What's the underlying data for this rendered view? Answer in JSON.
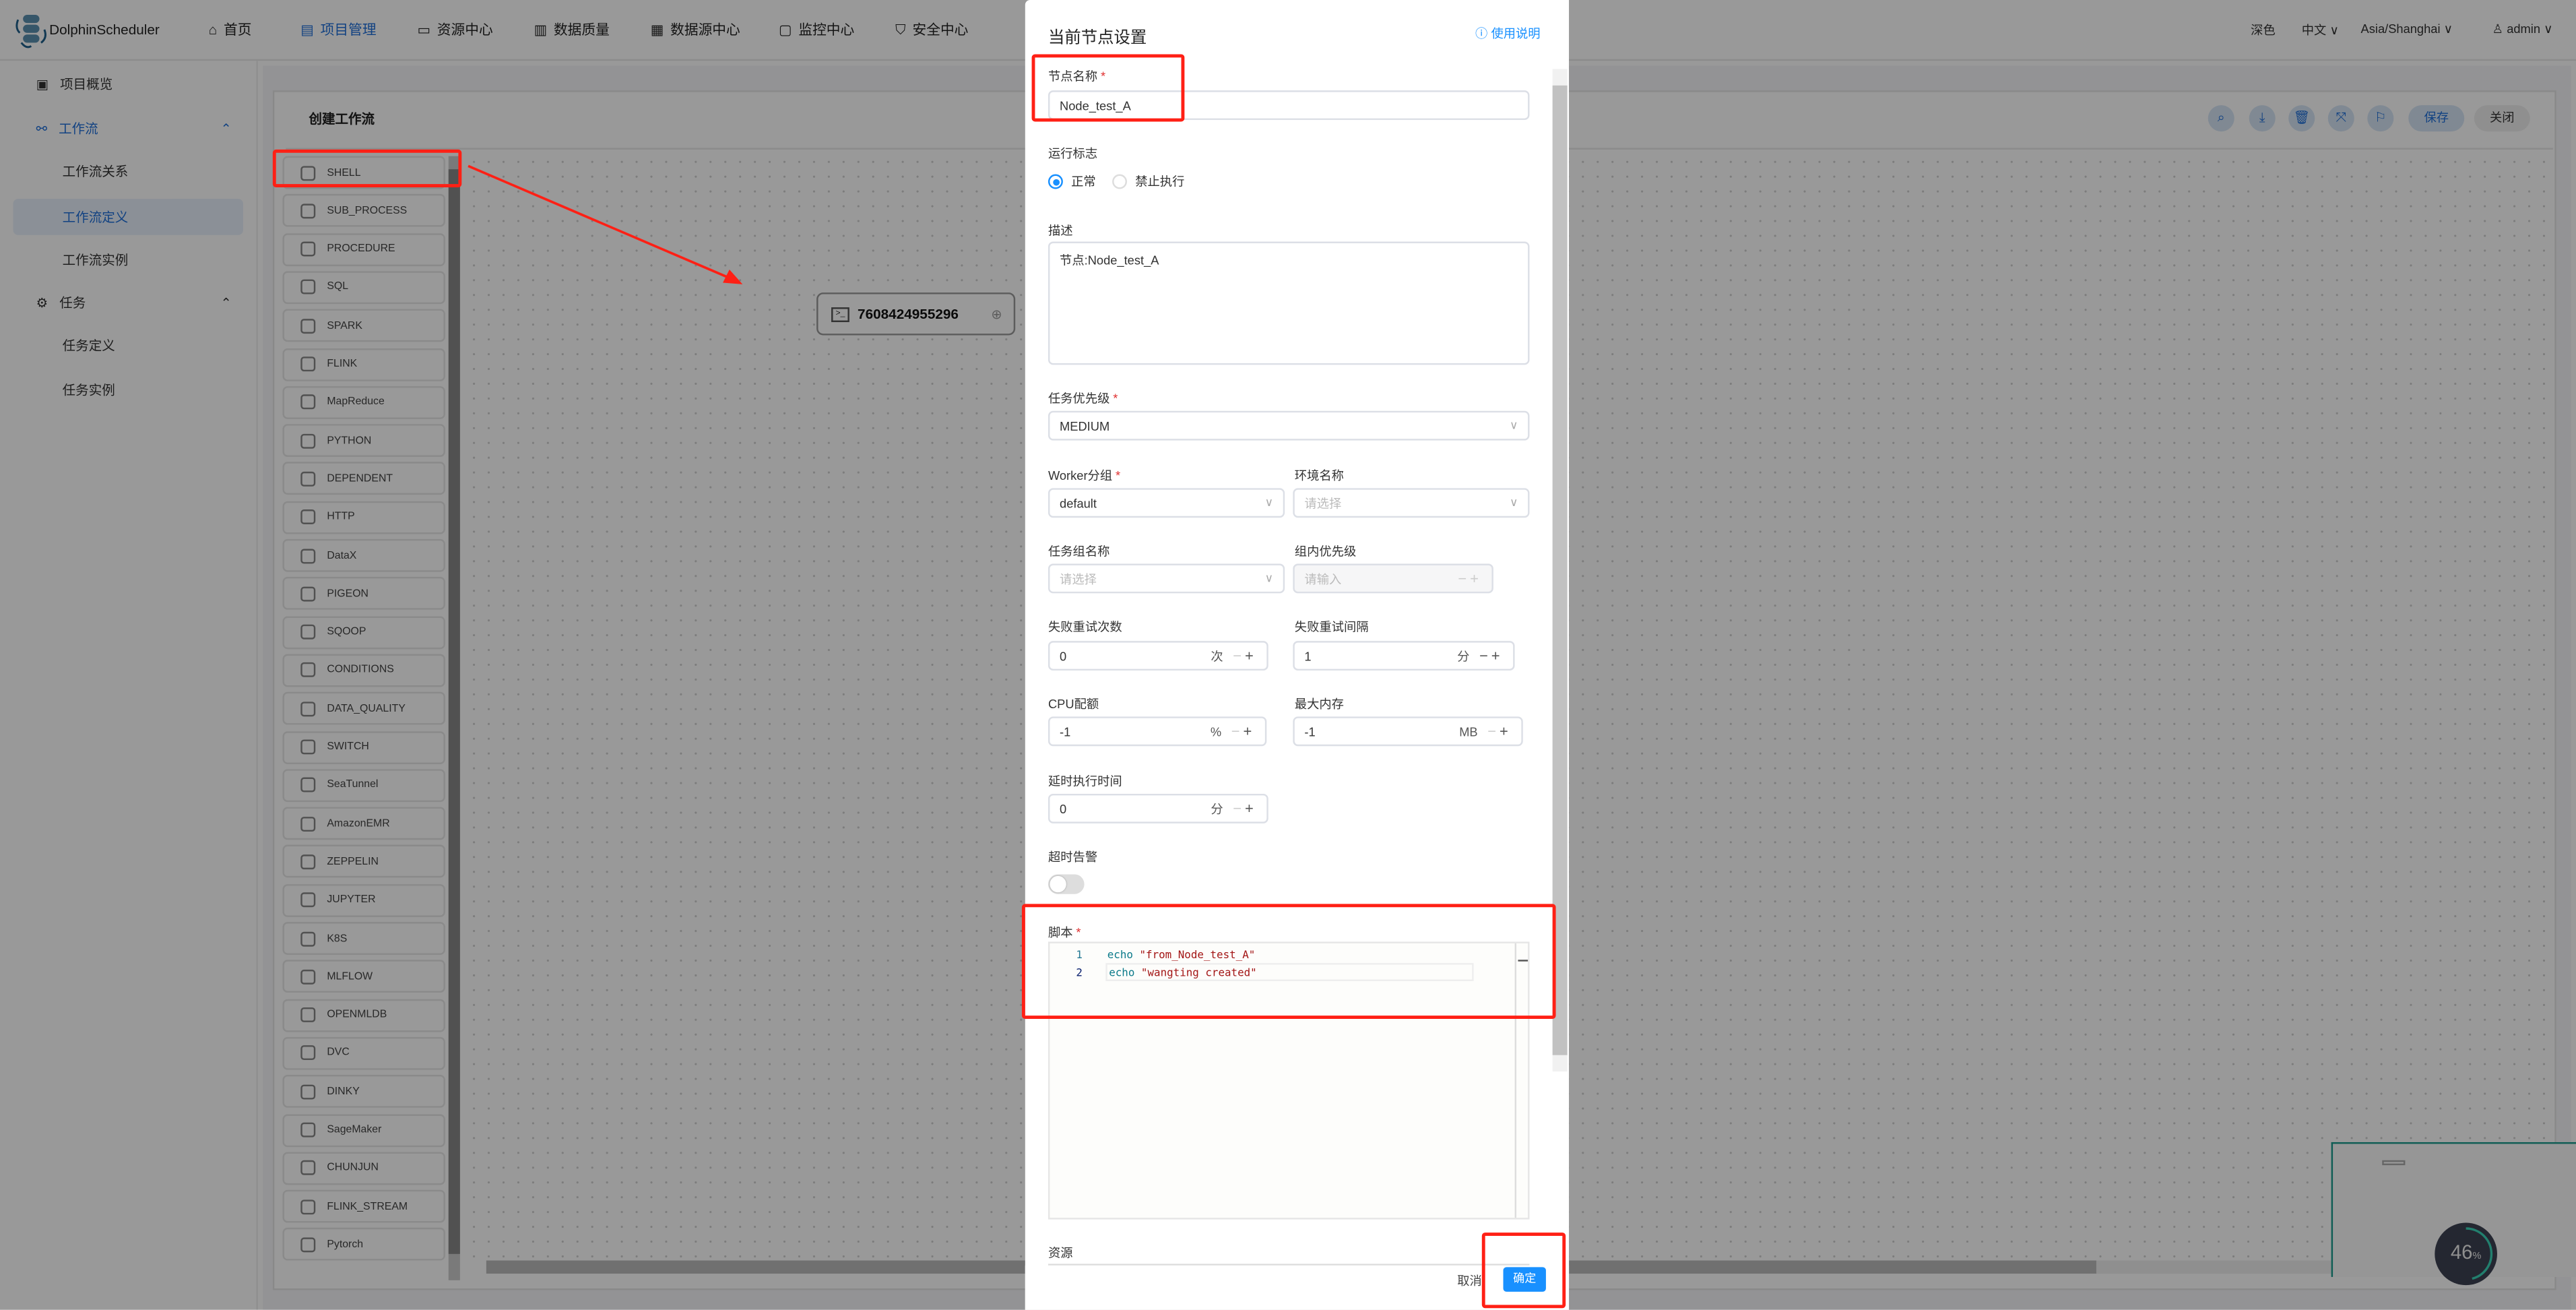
{
  "app": {
    "name": "DolphinScheduler"
  },
  "nav": [
    {
      "label": "首页",
      "icon": "home-icon"
    },
    {
      "label": "项目管理",
      "icon": "project-icon",
      "active": true
    },
    {
      "label": "资源中心",
      "icon": "folder-icon"
    },
    {
      "label": "数据质量",
      "icon": "data-quality-icon"
    },
    {
      "label": "数据源中心",
      "icon": "datasource-icon"
    },
    {
      "label": "监控中心",
      "icon": "monitor-icon"
    },
    {
      "label": "安全中心",
      "icon": "shield-icon"
    }
  ],
  "header_right": {
    "theme": "深色",
    "language": "中文",
    "timezone": "Asia/Shanghai",
    "user": "admin"
  },
  "sidebar": {
    "overview": "项目概览",
    "workflow": "工作流",
    "workflow_items": [
      "工作流关系",
      "工作流定义",
      "工作流实例"
    ],
    "task": "任务",
    "task_items": [
      "任务定义",
      "任务实例"
    ]
  },
  "editor": {
    "title": "创建工作流",
    "toolbar": {
      "save": "保存",
      "close": "关闭"
    },
    "tasks": [
      "SHELL",
      "SUB_PROCESS",
      "PROCEDURE",
      "SQL",
      "SPARK",
      "FLINK",
      "MapReduce",
      "PYTHON",
      "DEPENDENT",
      "HTTP",
      "DataX",
      "PIGEON",
      "SQOOP",
      "CONDITIONS",
      "DATA_QUALITY",
      "SWITCH",
      "SeaTunnel",
      "AmazonEMR",
      "ZEPPELIN",
      "JUPYTER",
      "K8S",
      "MLFLOW",
      "OPENMLDB",
      "DVC",
      "DINKY",
      "SageMaker",
      "CHUNJUN",
      "FLINK_STREAM",
      "Pytorch"
    ],
    "node": {
      "name": "7608424955296"
    },
    "progress": {
      "value": 46,
      "label": "46",
      "unit": "%"
    }
  },
  "modal": {
    "title": "当前节点设置",
    "help": "使用说明",
    "node_name": {
      "label": "节点名称",
      "value": "Node_test_A"
    },
    "run_flag": {
      "label": "运行标志",
      "options": [
        "正常",
        "禁止执行"
      ],
      "selected": "正常"
    },
    "description": {
      "label": "描述",
      "value": "节点:Node_test_A"
    },
    "priority": {
      "label": "任务优先级",
      "value": "MEDIUM"
    },
    "worker_group": {
      "label": "Worker分组",
      "value": "default"
    },
    "environment": {
      "label": "环境名称",
      "placeholder": "请选择"
    },
    "task_group": {
      "label": "任务组名称",
      "placeholder": "请选择"
    },
    "group_priority": {
      "label": "组内优先级",
      "placeholder": "请输入"
    },
    "retry_times": {
      "label": "失败重试次数",
      "value": "0",
      "unit": "次"
    },
    "retry_interval": {
      "label": "失败重试间隔",
      "value": "1",
      "unit": "分"
    },
    "cpu_quota": {
      "label": "CPU配额",
      "value": "-1",
      "unit": "%"
    },
    "max_memory": {
      "label": "最大内存",
      "value": "-1",
      "unit": "MB"
    },
    "delay_time": {
      "label": "延时执行时间",
      "value": "0",
      "unit": "分"
    },
    "timeout_alarm": {
      "label": "超时告警",
      "enabled": false
    },
    "script": {
      "label": "脚本",
      "lines": [
        {
          "num": "1",
          "kw": "echo",
          "str": "\"from_Node_test_A\""
        },
        {
          "num": "2",
          "kw": "echo",
          "str": "\"wangting created\""
        }
      ]
    },
    "resources": {
      "label": "资源"
    },
    "cancel": "取消",
    "confirm": "确定"
  },
  "colors": {
    "primary": "#1e6fd9",
    "confirm": "#1890ff",
    "annotation": "#ff2015",
    "string": "#a31515",
    "keyword": "#0b7a8a"
  }
}
